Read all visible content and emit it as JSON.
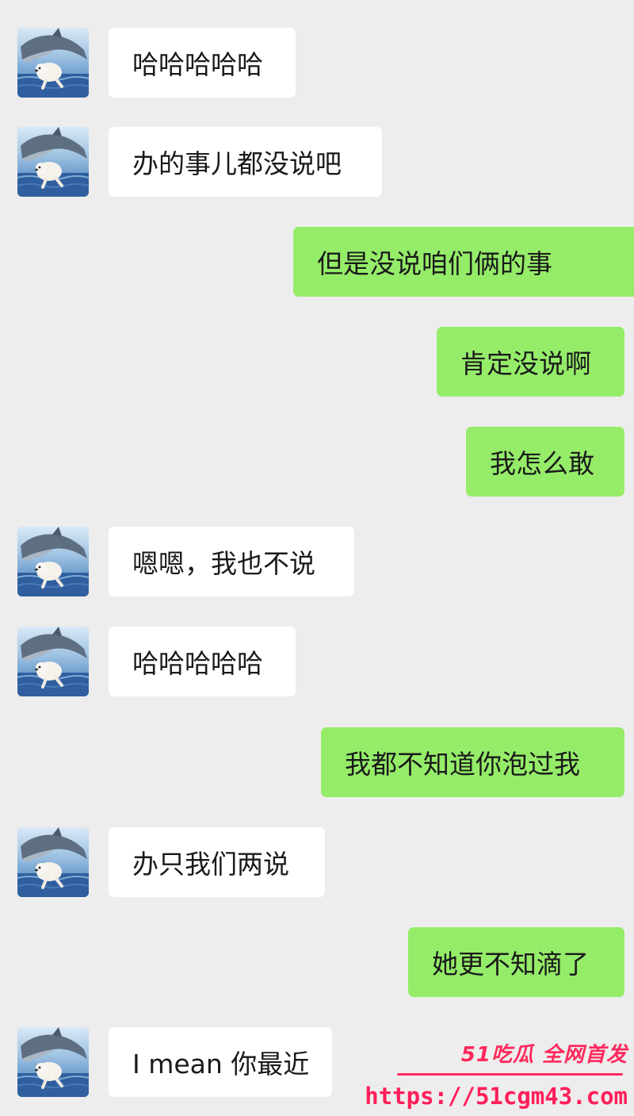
{
  "messages": [
    {
      "side": "in",
      "text": "哈哈哈哈哈"
    },
    {
      "side": "in",
      "text": "办的事儿都没说吧"
    },
    {
      "side": "out",
      "text": "但是没说咱们俩的事"
    },
    {
      "side": "out",
      "text": "肯定没说啊"
    },
    {
      "side": "out",
      "text": "我怎么敢"
    },
    {
      "side": "in",
      "text": "嗯嗯，我也不说"
    },
    {
      "side": "in",
      "text": "哈哈哈哈哈"
    },
    {
      "side": "out",
      "text": "我都不知道你泡过我"
    },
    {
      "side": "in",
      "text": "办只我们两说"
    },
    {
      "side": "out",
      "text": "她更不知滴了"
    },
    {
      "side": "in",
      "text": "I mean 你最近"
    }
  ],
  "watermark": {
    "brand": "51吃瓜 全网首发",
    "url": "https://51cgm43.com"
  },
  "colors": {
    "incoming_bubble": "#ffffff",
    "outgoing_bubble": "#95ec69",
    "background": "#ededed",
    "watermark": "#ff2a5c"
  }
}
